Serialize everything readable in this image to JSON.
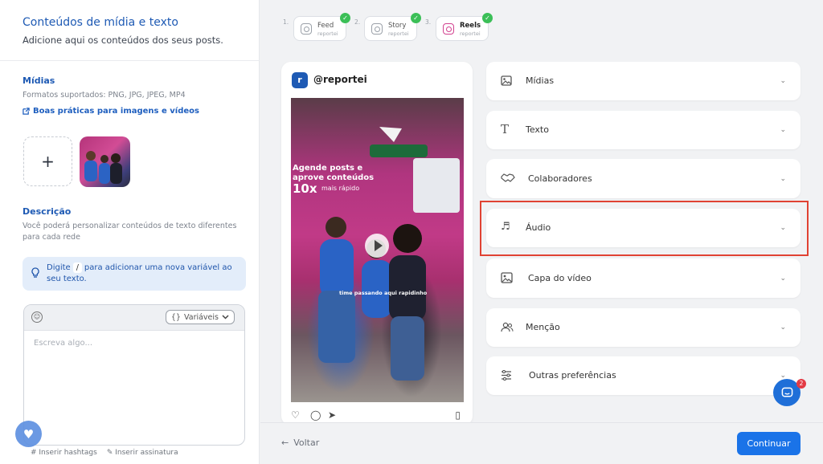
{
  "left_panel": {
    "title": "Conteúdos de mídia e texto",
    "subtitle": "Adicione aqui os conteúdos dos seus posts.",
    "media": {
      "title": "Mídias",
      "formats": "Formatos suportados: PNG, JPG, JPEG, MP4",
      "link": "Boas práticas para imagens e vídeos",
      "add_symbol": "+"
    },
    "description": {
      "title": "Descrição",
      "text": "Você poderá personalizar conteúdos de texto diferentes para cada rede"
    },
    "tip": {
      "part1": "Digite",
      "key": "/",
      "part2": "para adicionar uma nova variável ao seu texto."
    },
    "editor": {
      "variables_label": "Variáveis",
      "variables_icon_text": "{}",
      "placeholder": "Escreva algo...",
      "insert_hashtags": "Inserir hashtags",
      "insert_signature": "Inserir assinatura"
    }
  },
  "steps": [
    {
      "num": "1.",
      "name": "Feed",
      "handle": "reportei",
      "active": false
    },
    {
      "num": "2.",
      "name": "Story",
      "handle": "reportei",
      "active": false
    },
    {
      "num": "3.",
      "name": "Reels",
      "handle": "reportei",
      "active": true
    }
  ],
  "preview": {
    "handle": "@reportei",
    "avatar_letter": "r",
    "overlay_lines": [
      "Agende posts e",
      "aprove conteúdos",
      "10x",
      "mais rápido"
    ],
    "caption": "time passando aqui rapidinho"
  },
  "accordion": [
    {
      "label": "Mídias",
      "icon": "image-icon"
    },
    {
      "label": "Texto",
      "icon": "text-icon"
    },
    {
      "label": "Colaboradores",
      "icon": "handshake-icon"
    },
    {
      "label": "Áudio",
      "icon": "music-note-icon"
    },
    {
      "label": "Capa do vídeo",
      "icon": "image-icon"
    },
    {
      "label": "Menção",
      "icon": "users-icon"
    },
    {
      "label": "Outras preferências",
      "icon": "sliders-icon"
    }
  ],
  "footer": {
    "back_label": "Voltar",
    "continue_label": "Continuar",
    "chat_badge": "2"
  },
  "colors": {
    "brand_blue": "#1e5ab4",
    "primary_button": "#1a73e8",
    "success_check": "#3bbf57",
    "highlight_border": "#e04233",
    "instagram_pink": "#d2418f"
  }
}
